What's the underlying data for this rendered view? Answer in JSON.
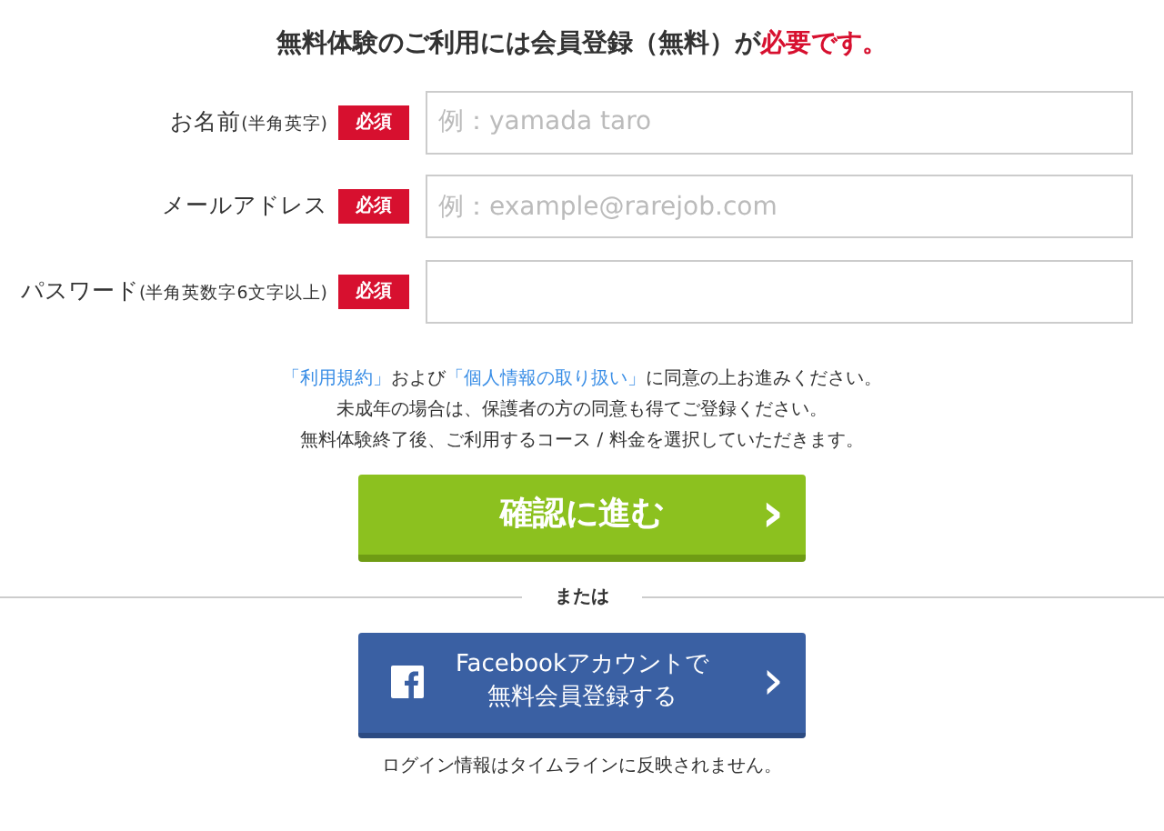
{
  "heading": {
    "text": "無料体験のご利用には会員登録（無料）が",
    "emphasis": "必要です。"
  },
  "fields": [
    {
      "label": "お名前",
      "note": "(半角英字)",
      "badge": "必須",
      "placeholder": "例：yamada taro"
    },
    {
      "label": "メールアドレス",
      "badge": "必須",
      "placeholder": "例：example@rarejob.com"
    },
    {
      "label": "パスワード",
      "note": "(半角英数字6文字以上)",
      "badge": "必須"
    }
  ],
  "notice": [
    [
      {
        "kind": "link",
        "text": "「利用規約」"
      },
      {
        "kind": "text",
        "text": "および"
      },
      {
        "kind": "link",
        "text": "「個人情報の取り扱い」"
      },
      {
        "kind": "text",
        "text": "に同意の上お進みください。"
      }
    ],
    [
      {
        "kind": "text",
        "text": "未成年の場合は、保護者の方の同意も得てご登録ください。"
      }
    ],
    [
      {
        "kind": "text",
        "text": "無料体験終了後、ご利用するコース / 料金を選択していただきます。"
      }
    ]
  ],
  "confirm_button": {
    "label": "確認に進む",
    "arrow": "›"
  },
  "divider": "または",
  "facebook_button": {
    "lines": [
      "Facebookアカウントで",
      "無料会員登録する"
    ],
    "arrow": "›"
  },
  "footer_note": "ログイン情報はタイムラインに反映されません。"
}
